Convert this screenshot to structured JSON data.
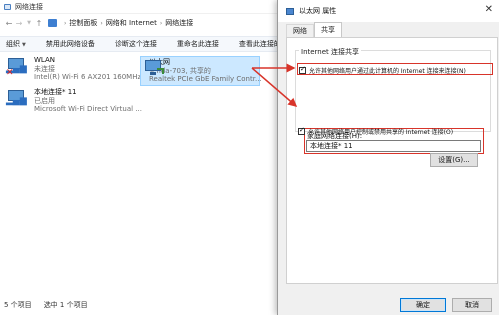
{
  "explorer": {
    "title": "网络连接",
    "breadcrumb": [
      "控制面板",
      "网络和 Internet",
      "网络连接"
    ],
    "toolbar": [
      "组织",
      "禁用此网络设备",
      "诊断这个连接",
      "重命名此连接",
      "查看此连接的状态"
    ],
    "items": [
      {
        "name": "WLAN",
        "status": "未连接",
        "adapter": "Intel(R) Wi-Fi 6 AX201 160MHz"
      },
      {
        "name": "以太网",
        "status": "Tenda-703, 共享的",
        "adapter": "Realtek PCIe GbE Family Contr..."
      },
      {
        "name": "本地连接* 11",
        "status": "已启用",
        "adapter": "Microsoft Wi-Fi Direct Virtual ..."
      }
    ],
    "status_bar": {
      "count": "5 个项目",
      "selected": "选中 1 个项目"
    }
  },
  "dialog": {
    "title": "以太网 属性",
    "tabs": [
      "网络",
      "共享"
    ],
    "active_tab": "共享",
    "group_label": "Internet 连接共享",
    "allow_sharing": {
      "label": "允许其他网络用户通过此计算机的 Internet 连接来连接(N)",
      "checked": true
    },
    "home_network_label": "家庭网络连接(H):",
    "home_network_value": "本地连接* 11",
    "allow_control": {
      "label": "允许其他网络用户控制或禁用共享的 Internet 连接(O)",
      "checked": true
    },
    "settings_button": "设置(G)...",
    "ok_button": "确定",
    "cancel_button": "取消"
  },
  "colors": {
    "annotation": "#d8342a",
    "selection": "#cce8ff",
    "accent": "#0078d7"
  }
}
